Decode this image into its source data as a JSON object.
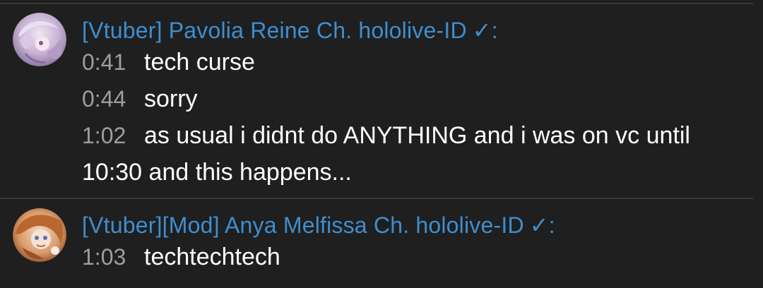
{
  "groups": [
    {
      "author": "[Vtuber] Pavolia Reine Ch. hololive-ID",
      "check": "✓:",
      "messages": [
        {
          "time": "0:41",
          "text": "tech curse"
        },
        {
          "time": "0:44",
          "text": "sorry"
        },
        {
          "time": "1:02",
          "text": "as usual i didnt do ANYTHING and i was on vc until 10:30 and this happens..."
        }
      ]
    },
    {
      "author": "[Vtuber][Mod] Anya Melfissa Ch. hololive-ID",
      "check": "✓:",
      "messages": [
        {
          "time": "1:03",
          "text": "techtechtech"
        }
      ]
    }
  ],
  "colors": {
    "background": "#1f1f1f",
    "author": "#3e8ed0",
    "timestamp": "#9e9e9e",
    "text": "#ffffff",
    "divider": "#3a3a3a"
  },
  "icons": [
    "verified-check-icon",
    "avatar-pavolia-reine",
    "avatar-anya-melfissa"
  ]
}
